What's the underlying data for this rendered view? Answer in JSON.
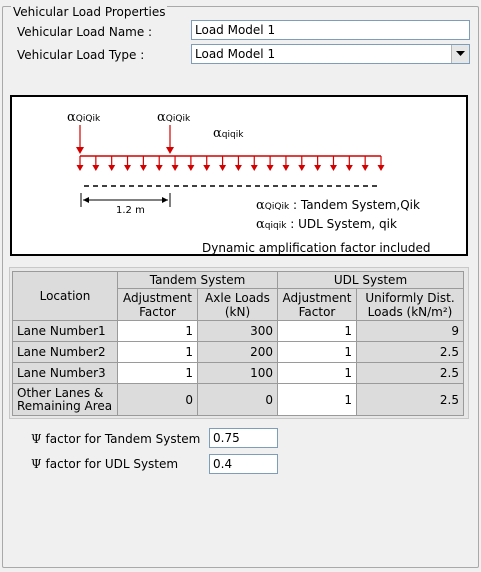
{
  "group_title": "Vehicular Load Properties",
  "name_label": "Vehicular Load Name :",
  "name_value": "Load Model 1",
  "type_label": "Vehicular Load Type :",
  "type_value": "Load Model 1",
  "diagram": {
    "alpha": "α",
    "sub_qiQik": "QiQik",
    "sub_qiqik": "qiqik",
    "dim_label": "1.2 m",
    "legend_tandem": ": Tandem System,Qik",
    "legend_udl": ": UDL System, qik",
    "note": "Dynamic amplification factor included",
    "colors": {
      "load": "#d40000",
      "line": "#000000"
    }
  },
  "table": {
    "group_headers": {
      "location": "Location",
      "tandem": "Tandem System",
      "udl": "UDL System"
    },
    "sub_headers": {
      "tandem_factor": [
        "Adjustment",
        "Factor"
      ],
      "axle_loads": [
        "Axle Loads",
        "(kN)"
      ],
      "udl_factor": [
        "Adjustment",
        "Factor"
      ],
      "udl_loads": [
        "Uniformly Dist.",
        "Loads (kN/m²)"
      ]
    },
    "rows": [
      {
        "location": [
          "Lane Number1"
        ],
        "tandem_factor": "1",
        "axle_load": "300",
        "udl_factor": "1",
        "udl_load": "9"
      },
      {
        "location": [
          "Lane Number2"
        ],
        "tandem_factor": "1",
        "axle_load": "200",
        "udl_factor": "1",
        "udl_load": "2.5"
      },
      {
        "location": [
          "Lane Number3"
        ],
        "tandem_factor": "1",
        "axle_load": "100",
        "udl_factor": "1",
        "udl_load": "2.5"
      },
      {
        "location": [
          "Other Lanes &",
          "Remaining Area"
        ],
        "tandem_factor": "0",
        "axle_load": "0",
        "udl_factor": "1",
        "udl_load": "2.5"
      }
    ]
  },
  "psi": {
    "symbol": "Ψ",
    "tandem_label": "factor for Tandem System",
    "tandem_value": "0.75",
    "udl_label": "factor for UDL System",
    "udl_value": "0.4"
  }
}
